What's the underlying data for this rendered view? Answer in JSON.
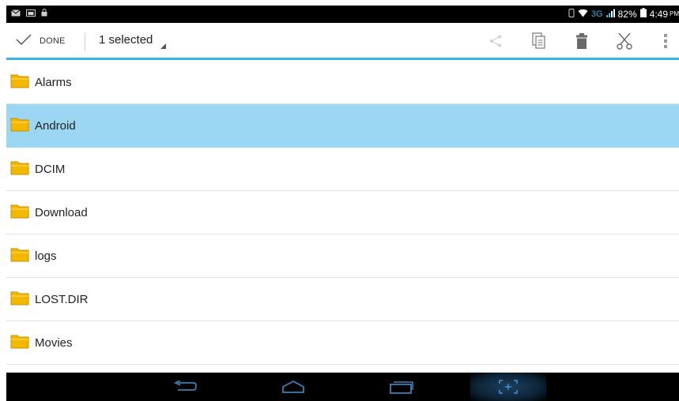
{
  "status_bar": {
    "notification_icons": [
      "mail-icon",
      "gallery-icon",
      "lock-icon"
    ],
    "network": "3G",
    "battery": "82%",
    "time": "4:49",
    "ampm": "PM"
  },
  "action_bar": {
    "done_label": "DONE",
    "selection_label": "1 selected",
    "actions": [
      "share-icon",
      "copy-icon",
      "delete-icon",
      "cut-icon",
      "overflow-menu-icon"
    ]
  },
  "files": [
    {
      "name": "Alarms",
      "selected": false
    },
    {
      "name": "Android",
      "selected": true
    },
    {
      "name": "DCIM",
      "selected": false
    },
    {
      "name": "Download",
      "selected": false
    },
    {
      "name": "logs",
      "selected": false
    },
    {
      "name": "LOST.DIR",
      "selected": false
    },
    {
      "name": "Movies",
      "selected": false
    }
  ],
  "nav_bar": {
    "buttons": [
      "back-icon",
      "home-icon",
      "recent-apps-icon",
      "screenshot-icon"
    ]
  },
  "colors": {
    "accent": "#33b5e5",
    "selected_row": "#9bd7f2",
    "folder": "#f5b800"
  }
}
